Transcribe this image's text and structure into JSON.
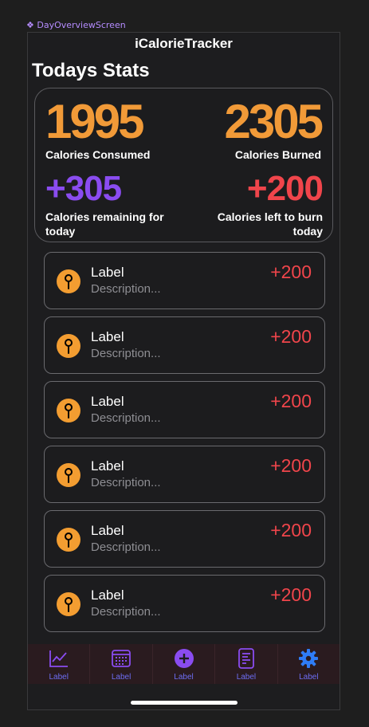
{
  "canvas_label": "❖ DayOverviewScreen",
  "app_title": "iCalorieTracker",
  "section_title": "Todays Stats",
  "stats": {
    "consumed": {
      "value": "1995",
      "caption": "Calories Consumed"
    },
    "burned": {
      "value": "2305",
      "caption": "Calories Burned"
    },
    "remaining": {
      "value": "+305",
      "caption": "Calories remaining for today"
    },
    "to_burn": {
      "value": "+200",
      "caption": "Calories left to burn today"
    }
  },
  "colors": {
    "orange": "#f19a38",
    "purple": "#8a4cf0",
    "red": "#f0454b",
    "tab_accent": "#6d6df2"
  },
  "entries": [
    {
      "label": "Label",
      "description": "Description...",
      "value": "+200",
      "icon": "pin-icon"
    },
    {
      "label": "Label",
      "description": "Description...",
      "value": "+200",
      "icon": "pin-icon"
    },
    {
      "label": "Label",
      "description": "Description...",
      "value": "+200",
      "icon": "pin-icon"
    },
    {
      "label": "Label",
      "description": "Description...",
      "value": "+200",
      "icon": "pin-icon"
    },
    {
      "label": "Label",
      "description": "Description...",
      "value": "+200",
      "icon": "pin-icon"
    },
    {
      "label": "Label",
      "description": "Description...",
      "value": "+200",
      "icon": "pin-icon"
    }
  ],
  "tabs": [
    {
      "label": "Label",
      "icon": "chart-icon"
    },
    {
      "label": "Label",
      "icon": "calendar-icon"
    },
    {
      "label": "Label",
      "icon": "add-circle-icon"
    },
    {
      "label": "Label",
      "icon": "document-icon"
    },
    {
      "label": "Label",
      "icon": "gear-icon"
    }
  ]
}
